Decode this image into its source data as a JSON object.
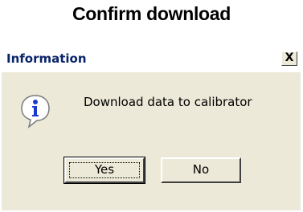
{
  "caption": "Confirm download",
  "dialog": {
    "title": "Information",
    "close_label": "X",
    "message": "Download data to calibrator",
    "buttons": {
      "yes": "Yes",
      "no": "No"
    },
    "icon": "information-icon"
  },
  "colors": {
    "dialog_bg": "#ece9d8",
    "title_text": "#0a246a",
    "icon_blue": "#1a3ad0"
  }
}
